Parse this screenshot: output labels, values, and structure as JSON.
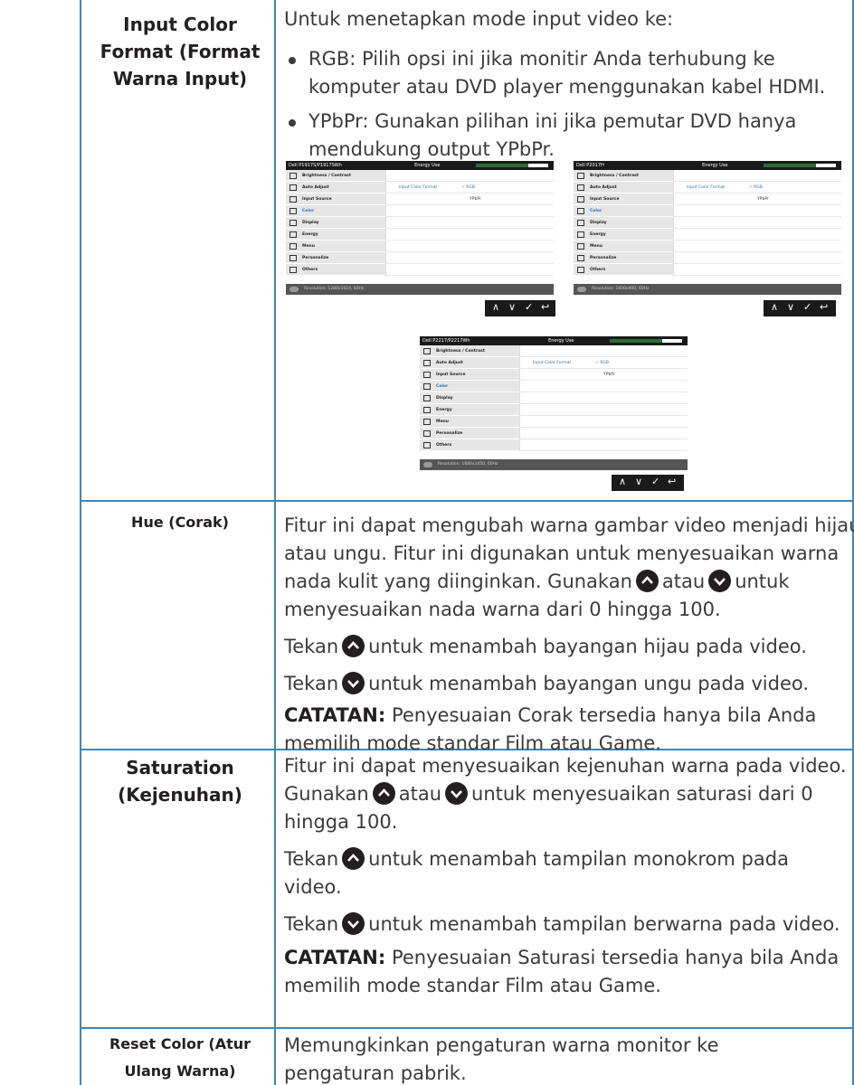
{
  "rows": [
    {
      "label": "Input Color Format (Format Warna Input)",
      "intro": "Untuk menetapkan mode input video ke:",
      "bullets": [
        "RGB: Pilih opsi ini jika monitir Anda terhubung ke komputer atau DVD player menggunakan kabel HDMI.",
        "YPbPr: Gunakan pilihan ini jika pemutar DVD hanya mendukung output YPbPr."
      ]
    },
    {
      "label": "Hue (Corak)",
      "p1_a": "Fitur ini dapat mengubah warna gambar video menjadi hijau atau ungu. Fitur ini digunakan untuk menyesuaikan warna nada kulit yang diinginkan. Gunakan",
      "p1_b": "atau",
      "p1_c": "untuk menyesuaikan nada warna dari 0 hingga 100.",
      "p2_a": "Tekan",
      "p2_b": "untuk menambah bayangan hijau pada video.",
      "p3_a": "Tekan",
      "p3_b": "untuk menambah bayangan ungu pada video.",
      "note_label": "CATATAN:",
      "note_text": " Penyesuaian Corak tersedia hanya bila Anda memilih mode standar Film atau Game."
    },
    {
      "label": "Saturation (Kejenuhan)",
      "p1_a": "Fitur ini dapat menyesuaikan kejenuhan warna pada video. Gunakan",
      "p1_b": "atau",
      "p1_c": "untuk menyesuaikan saturasi dari 0 hingga 100.",
      "p2_a": "Tekan",
      "p2_b": "untuk menambah tampilan monokrom pada video.",
      "p3_a": "Tekan",
      "p3_b": "untuk menambah tampilan berwarna pada video.",
      "note_label": "CATATAN:",
      "note_text": " Penyesuaian Saturasi tersedia hanya bila Anda memilih mode standar Film atau Game."
    },
    {
      "label": "Reset Color (Atur Ulang Warna)",
      "text": "Memungkinkan pengaturan warna monitor ke pengaturan pabrik."
    }
  ],
  "osd_menu_items": [
    "Brightness / Contrast",
    "Auto Adjust",
    "Input Source",
    "Color",
    "Display",
    "Energy",
    "Menu",
    "Personalize",
    "Others"
  ],
  "osd_energy_label": "Energy Use",
  "osd_option_label": "Input Color Format",
  "osd_option_rgb": "✓ RGB",
  "osd_option_ypbpr": "YPbPr",
  "osd_buttons": [
    "∧",
    "∨",
    "✓",
    "↩"
  ],
  "osds": [
    {
      "model": "Dell P1917S/P1917SWh",
      "resolution": "Resolution: 1280x1024, 60Hz"
    },
    {
      "model": "Dell P2017H",
      "resolution": "Resolution: 1600x900, 60Hz"
    },
    {
      "model": "Dell P2217/P2217Wh",
      "resolution": "Resolution: 1680x1050, 60Hz"
    }
  ]
}
